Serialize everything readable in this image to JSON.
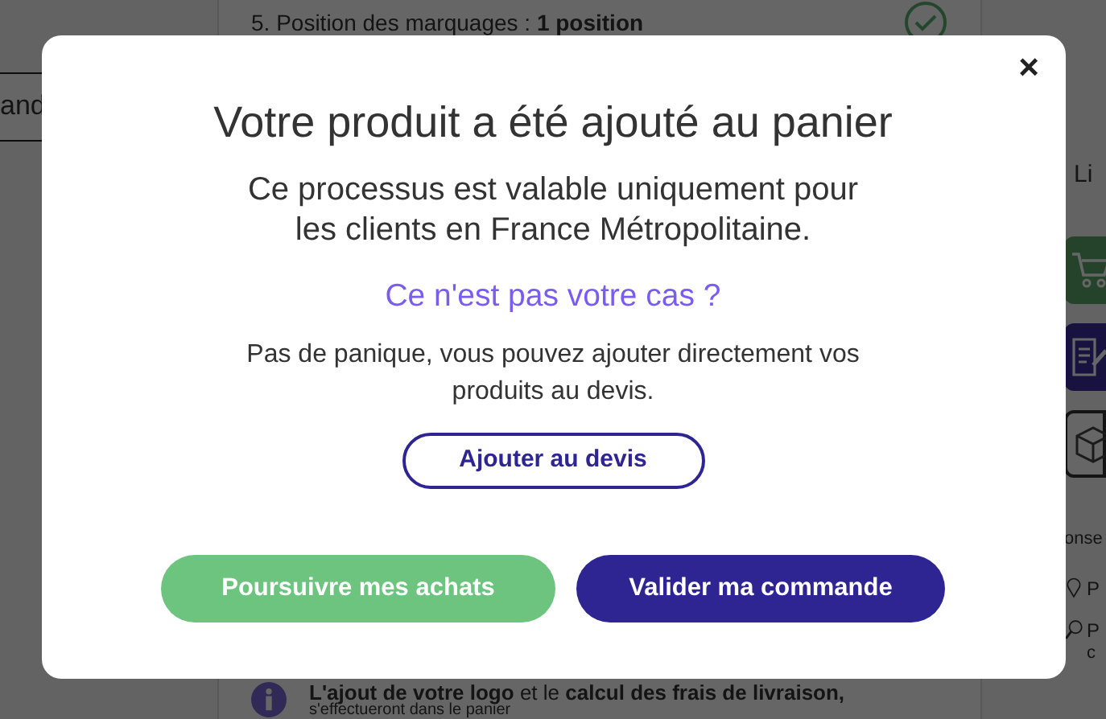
{
  "background": {
    "step": "5. Position des marquages : **1 position**",
    "left_tab": "and",
    "right_label": "Li",
    "right_heading": "onse",
    "right_items": [
      {
        "text": "P"
      },
      {
        "text": "P",
        "sub": "c"
      }
    ],
    "info": "**L'ajout de votre logo** et le **calcul des frais de livraison,**",
    "info_sub": "s'effectueront dans le panier"
  },
  "modal": {
    "close": "×",
    "title": "Votre produit a été ajouté au panier",
    "message": "Ce processus est valable uniquement pour les clients en France Métropolitaine.",
    "question": "Ce n'est pas votre cas ?",
    "hint": "Pas de panique, vous pouvez ajouter directement vos produits au devis.",
    "quote_button": "Ajouter au devis",
    "buttons": [
      {
        "kind": "secondary",
        "label": "Poursuivre mes achats"
      },
      {
        "kind": "primary",
        "label": "Valider ma commande"
      }
    ]
  }
}
